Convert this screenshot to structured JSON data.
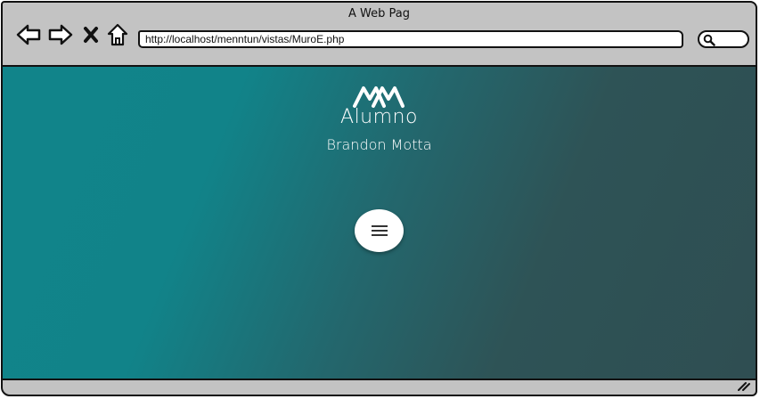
{
  "window": {
    "title": "A Web Pag"
  },
  "toolbar": {
    "back_icon": "back-arrow-icon",
    "forward_icon": "forward-arrow-icon",
    "stop_icon": "close-icon",
    "home_icon": "home-icon",
    "url": "http://localhost/menntun/vistas/MuroE.php",
    "search_icon": "search-icon"
  },
  "main": {
    "logo_icon": "brand-logo-icon",
    "role": "Alumno",
    "user_name": "Brandon Motta",
    "menu_icon": "hamburger-menu-icon"
  },
  "colors": {
    "gradient_start": "#11848a",
    "gradient_end": "#2f4e52",
    "chrome": "#c3c3c3"
  }
}
